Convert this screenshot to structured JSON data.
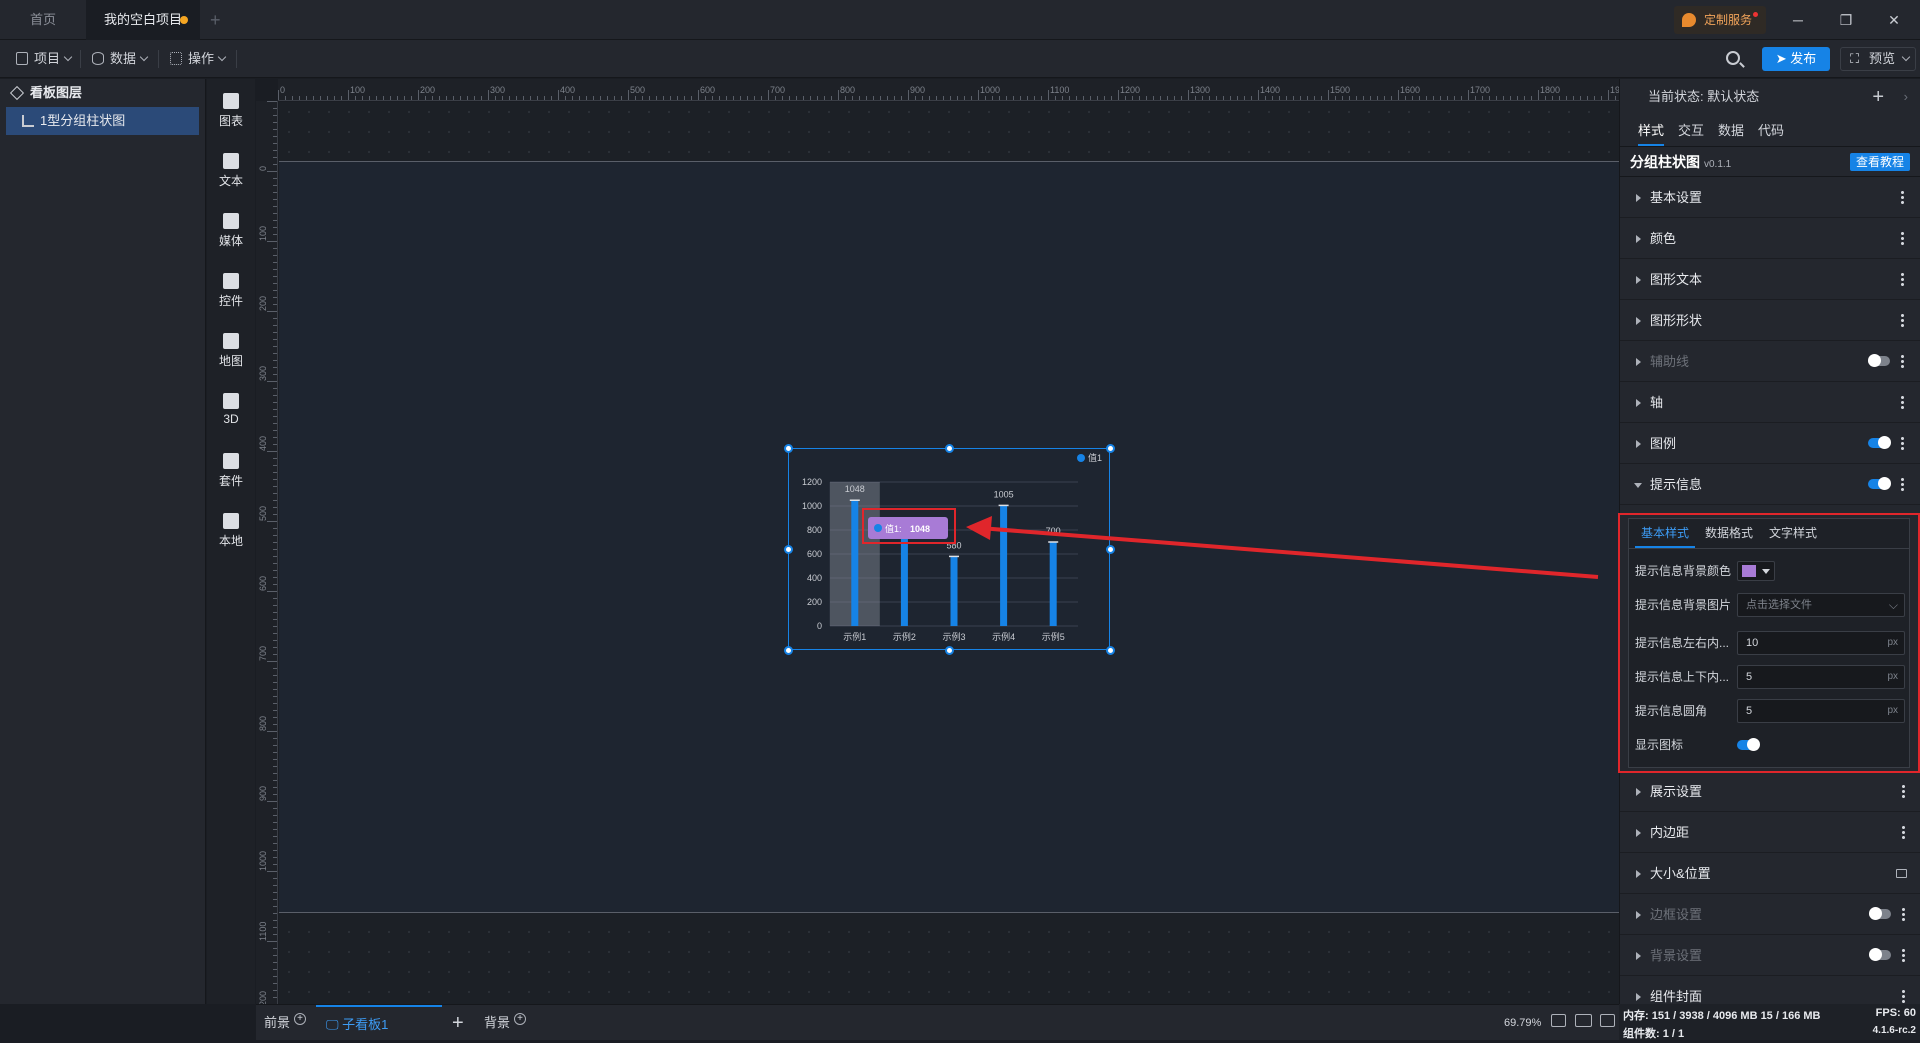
{
  "tabs": [
    {
      "label": "首页"
    },
    {
      "label": "我的空白项目"
    }
  ],
  "header": {
    "custom_service": "定制服务"
  },
  "toolbar": {
    "project": "项目",
    "data": "数据",
    "operate": "操作",
    "publish": "发布",
    "preview": "预览"
  },
  "layers": {
    "title": "看板图层",
    "item": "1型分组柱状图"
  },
  "icon_bar": [
    {
      "label": "图表",
      "icon": "chart-icon"
    },
    {
      "label": "文本",
      "icon": "text-icon"
    },
    {
      "label": "媒体",
      "icon": "media-icon"
    },
    {
      "label": "控件",
      "icon": "control-icon"
    },
    {
      "label": "地图",
      "icon": "map-icon"
    },
    {
      "label": "3D",
      "icon": "cube-icon"
    },
    {
      "label": "套件",
      "icon": "kit-icon"
    },
    {
      "label": "本地",
      "icon": "puzzle-icon"
    }
  ],
  "ruler": {
    "h_ticks": [
      "0",
      "100",
      "200",
      "300",
      "400",
      "500",
      "600",
      "700",
      "800",
      "900",
      "1000",
      "1100",
      "1200",
      "1300",
      "1400",
      "1500",
      "1600",
      "1700",
      "1800",
      "1900"
    ],
    "v_ticks": [
      "0",
      "100",
      "200",
      "300",
      "400",
      "500",
      "600",
      "700",
      "800",
      "900",
      "1000",
      "1100",
      "1200"
    ]
  },
  "chart_data": {
    "type": "bar",
    "categories": [
      "示例1",
      "示例2",
      "示例3",
      "示例4",
      "示例5"
    ],
    "series": [
      {
        "name": "值1",
        "values": [
          1048,
          735,
          580,
          1005,
          700
        ]
      }
    ],
    "data_labels": [
      "1048",
      "",
      "580",
      "1005",
      "700"
    ],
    "yticks": [
      "0",
      "200",
      "400",
      "600",
      "800",
      "1000",
      "1200"
    ],
    "ylim": [
      0,
      1200
    ],
    "legend": "top-right",
    "highlight_category": "示例1",
    "tooltip": {
      "label": "值1:",
      "value": "1048",
      "bg_color": "#a87bd6"
    },
    "bar_color": "#1683e6"
  },
  "right_panel": {
    "state_label": "当前状态:",
    "state_value": "默认状态",
    "tabs": [
      "样式",
      "交互",
      "数据",
      "代码"
    ],
    "component_name": "分组柱状图",
    "version": "v0.1.1",
    "tutorial": "查看教程",
    "sections": [
      {
        "label": "基本设置"
      },
      {
        "label": "颜色"
      },
      {
        "label": "图形文本"
      },
      {
        "label": "图形形状"
      },
      {
        "label": "辅助线"
      },
      {
        "label": "轴"
      },
      {
        "label": "图例"
      },
      {
        "label": "提示信息"
      },
      {
        "label": "展示设置"
      },
      {
        "label": "内边距"
      },
      {
        "label": "大小&位置"
      },
      {
        "label": "边框设置"
      },
      {
        "label": "背景设置"
      },
      {
        "label": "组件封面"
      }
    ],
    "tooltip_settings": {
      "tabs": [
        "基本样式",
        "数据格式",
        "文字样式"
      ],
      "bg_color_label": "提示信息背景颜色",
      "bg_color": "#a87bd6",
      "bg_image_label": "提示信息背景图片",
      "bg_image_placeholder": "点击选择文件",
      "padding_lr_label": "提示信息左右内...",
      "padding_lr": "10",
      "padding_tb_label": "提示信息上下内...",
      "padding_tb": "5",
      "radius_label": "提示信息圆角",
      "radius": "5",
      "unit": "px",
      "show_icon_label": "显示图标"
    }
  },
  "bottom": {
    "foreground": "前景",
    "sub_board": "子看板1",
    "background": "背景",
    "zoom": "69.79%"
  },
  "status": {
    "memory": "内存: 151 / 3938 / 4096 MB 15 / 166 MB",
    "fps": "FPS: 60",
    "components": "组件数: 1 / 1",
    "version": "4.1.6-rc.2"
  }
}
